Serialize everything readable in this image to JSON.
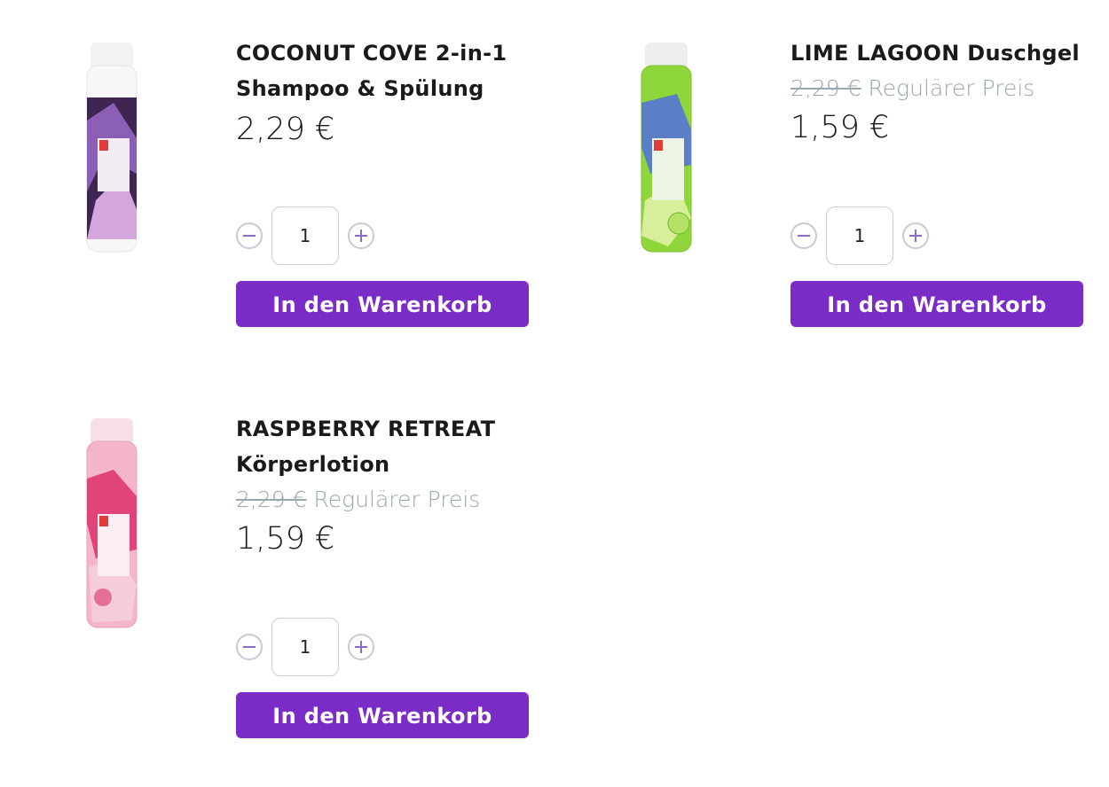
{
  "products": [
    {
      "title": "COCONUT COVE 2-in-1 Shampoo & Spülung",
      "price": "2,29 €",
      "qty": "1",
      "cart_label": "In den Warenkorb",
      "image_icon": "shampoo-bottle-icon"
    },
    {
      "title": "LIME LAGOON Duschgel",
      "old_price": "2,29 €",
      "regular_label": "Regulärer Preis",
      "price": "1,59 €",
      "qty": "1",
      "cart_label": "In den Warenkorb",
      "image_icon": "shower-gel-bottle-icon"
    },
    {
      "title": "RASPBERRY RETREAT Körperlotion",
      "old_price": "2,29 €",
      "regular_label": "Regulärer Preis",
      "price": "1,59 €",
      "qty": "1",
      "cart_label": "In den Warenkorb",
      "image_icon": "body-lotion-bottle-icon"
    }
  ],
  "colors": {
    "accent": "#7b2bc6",
    "muted_text": "#9aa7ac",
    "stepper_icon": "#8f6cc4"
  }
}
